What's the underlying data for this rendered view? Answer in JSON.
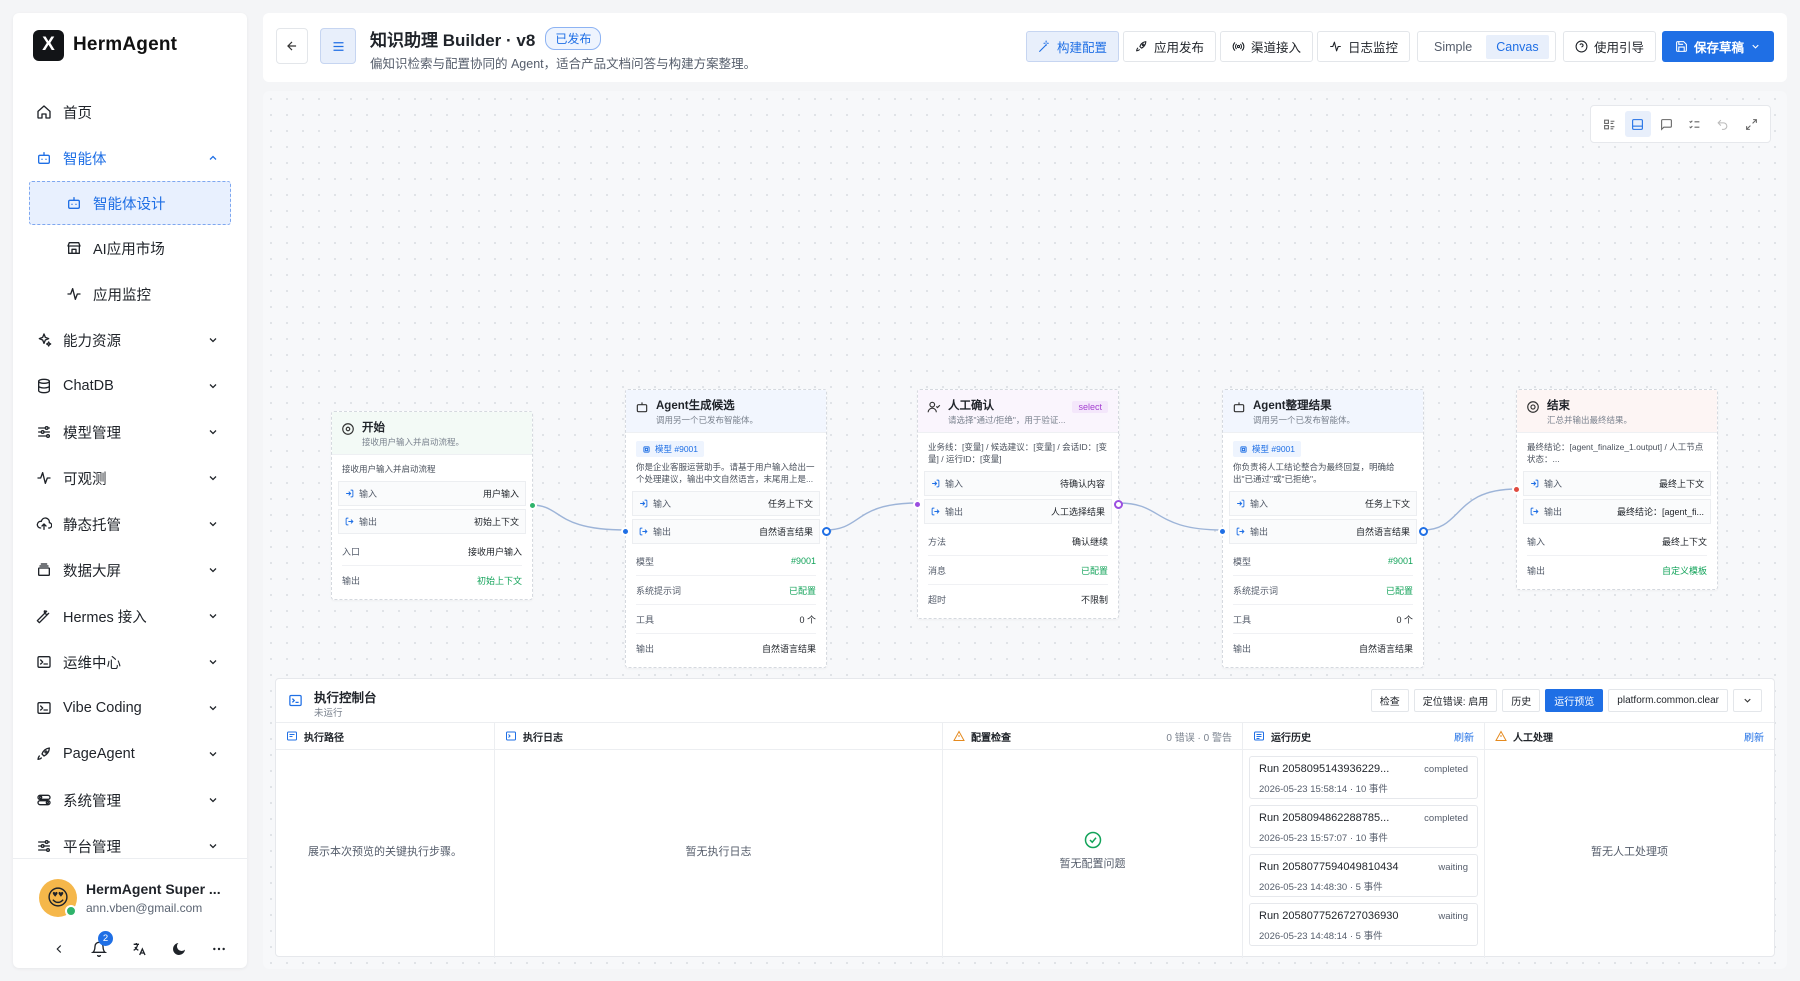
{
  "brand": {
    "logo": "X",
    "name": "HermAgent"
  },
  "menu": [
    {
      "name": "home",
      "label": "首页",
      "icon": "home-icon"
    },
    {
      "name": "agents",
      "label": "智能体",
      "icon": "robot-icon",
      "expanded": true
    },
    {
      "name": "agent-design",
      "label": "智能体设计",
      "icon": "robot-icon",
      "sub": true,
      "selected": true
    },
    {
      "name": "ai-market",
      "label": "AI应用市场",
      "icon": "store-icon",
      "sub": true
    },
    {
      "name": "app-monitor",
      "label": "应用监控",
      "icon": "activity-icon",
      "sub": true
    },
    {
      "name": "capabilities",
      "label": "能力资源",
      "icon": "sparkles-icon"
    },
    {
      "name": "chatdb",
      "label": "ChatDB",
      "icon": "database-icon"
    },
    {
      "name": "models",
      "label": "模型管理",
      "icon": "sliders-icon"
    },
    {
      "name": "observability",
      "label": "可观测",
      "icon": "activity-icon"
    },
    {
      "name": "hosting",
      "label": "静态托管",
      "icon": "cloud-upload-icon"
    },
    {
      "name": "dashboard",
      "label": "数据大屏",
      "icon": "stack-icon"
    },
    {
      "name": "hermes",
      "label": "Hermes 接入",
      "icon": "wrench-icon"
    },
    {
      "name": "ops",
      "label": "运维中心",
      "icon": "terminal-icon"
    },
    {
      "name": "vibe",
      "label": "Vibe Coding",
      "icon": "terminal-icon"
    },
    {
      "name": "pageagent",
      "label": "PageAgent",
      "icon": "rocket-icon"
    },
    {
      "name": "system",
      "label": "系统管理",
      "icon": "toggle-icon"
    },
    {
      "name": "platform",
      "label": "平台管理",
      "icon": "sliders-icon"
    }
  ],
  "user": {
    "name": "HermAgent Super ...",
    "email": "ann.vben@gmail.com",
    "avatar": "😍",
    "notifications": "2"
  },
  "header": {
    "title": "知识助理 Builder · v8",
    "status": "已发布",
    "description": "偏知识检索与配置协同的 Agent，适合产品文档问答与构建方案整理。",
    "tabs": [
      {
        "label": "构建配置",
        "icon": "wand-icon",
        "active": true
      },
      {
        "label": "应用发布",
        "icon": "rocket-icon"
      },
      {
        "label": "渠道接入",
        "icon": "broadcast-icon"
      },
      {
        "label": "日志监控",
        "icon": "activity-icon"
      }
    ],
    "modes": [
      {
        "label": "Simple"
      },
      {
        "label": "Canvas",
        "active": true
      }
    ],
    "guide": "使用引导",
    "save": "保存草稿"
  },
  "nodes": {
    "start": {
      "title": "开始",
      "subtitle": "接收用户输入并启动流程。",
      "desc": "接收用户输入并启动流程",
      "rows": [
        {
          "k": "输入",
          "v": "用户输入",
          "io": "in"
        },
        {
          "k": "输出",
          "v": "初始上下文",
          "io": "out"
        },
        {
          "k": "入口",
          "v": "接收用户输入"
        },
        {
          "k": "输出",
          "v": "初始上下文",
          "green": true
        }
      ]
    },
    "agent1": {
      "title": "Agent生成候选",
      "subtitle": "调用另一个已发布智能体。",
      "model": "模型 #9001",
      "desc": "你是企业客服运营助手。请基于用户输入给出一个处理建议，输出中文自然语言，末尾用上是...",
      "rows": [
        {
          "k": "输入",
          "v": "任务上下文",
          "io": "in"
        },
        {
          "k": "输出",
          "v": "自然语言结果",
          "io": "out"
        },
        {
          "k": "模型",
          "v": "#9001",
          "green": true
        },
        {
          "k": "系统提示词",
          "v": "已配置",
          "green": true
        },
        {
          "k": "工具",
          "v": "0 个"
        },
        {
          "k": "输出",
          "v": "自然语言结果"
        }
      ]
    },
    "human": {
      "title": "人工确认",
      "subtitle": "请选择\"通过/拒绝\"，用于验证...",
      "tag": "select",
      "desc": "业务线：[变量] / 候选建议：[变量] / 会话ID：[变量] / 运行ID：[变量]",
      "rows": [
        {
          "k": "输入",
          "v": "待确认内容",
          "io": "in"
        },
        {
          "k": "输出",
          "v": "人工选择结果",
          "io": "out"
        },
        {
          "k": "方法",
          "v": "确认继续"
        },
        {
          "k": "消息",
          "v": "已配置",
          "green": true
        },
        {
          "k": "超时",
          "v": "不限制"
        }
      ]
    },
    "agent2": {
      "title": "Agent整理结果",
      "subtitle": "调用另一个已发布智能体。",
      "model": "模型 #9001",
      "desc": "你负责将人工结论整合为最终回复，明确给出\"已通过\"或\"已拒绝\"。",
      "rows": [
        {
          "k": "输入",
          "v": "任务上下文",
          "io": "in"
        },
        {
          "k": "输出",
          "v": "自然语言结果",
          "io": "out"
        },
        {
          "k": "模型",
          "v": "#9001",
          "green": true
        },
        {
          "k": "系统提示词",
          "v": "已配置",
          "green": true
        },
        {
          "k": "工具",
          "v": "0 个"
        },
        {
          "k": "输出",
          "v": "自然语言结果"
        }
      ]
    },
    "end": {
      "title": "结束",
      "subtitle": "汇总并输出最终结果。",
      "desc": "最终结论：[agent_finalize_1.output] / 人工节点状态：...",
      "rows": [
        {
          "k": "输入",
          "v": "最终上下文",
          "io": "in"
        },
        {
          "k": "输出",
          "v": "最终结论：[agent_fi...",
          "io": "out"
        },
        {
          "k": "输入",
          "v": "最终上下文"
        },
        {
          "k": "输出",
          "v": "自定义模板",
          "green": true
        }
      ]
    }
  },
  "console": {
    "title": "执行控制台",
    "status": "未运行",
    "buttons": [
      "检查",
      "定位错误: 启用",
      "历史",
      "运行预览",
      "platform.common.clear"
    ],
    "panes": {
      "path": {
        "title": "执行路径",
        "empty": "展示本次预览的关键执行步骤。"
      },
      "log": {
        "title": "执行日志",
        "empty": "暂无执行日志"
      },
      "check": {
        "title": "配置检查",
        "summary": "0 错误 · 0 警告",
        "empty": "暂无配置问题"
      },
      "history": {
        "title": "运行历史",
        "refresh": "刷新",
        "runs": [
          {
            "id": "Run 2058095143936229...",
            "status": "completed",
            "time": "2026-05-23 15:58:14 · 10 事件"
          },
          {
            "id": "Run 2058094862288785...",
            "status": "completed",
            "time": "2026-05-23 15:57:07 · 10 事件"
          },
          {
            "id": "Run 2058077594049810434",
            "status": "waiting",
            "time": "2026-05-23 14:48:30 · 5 事件"
          },
          {
            "id": "Run 2058077526727036930",
            "status": "waiting",
            "time": "2026-05-23 14:48:14 · 5 事件"
          }
        ]
      },
      "manual": {
        "title": "人工处理",
        "refresh": "刷新",
        "empty": "暂无人工处理项"
      }
    }
  },
  "colors": {
    "primary": "#1f6fe5",
    "green": "#13a35a",
    "purple": "#a43fd1",
    "red": "#e04a3f"
  }
}
